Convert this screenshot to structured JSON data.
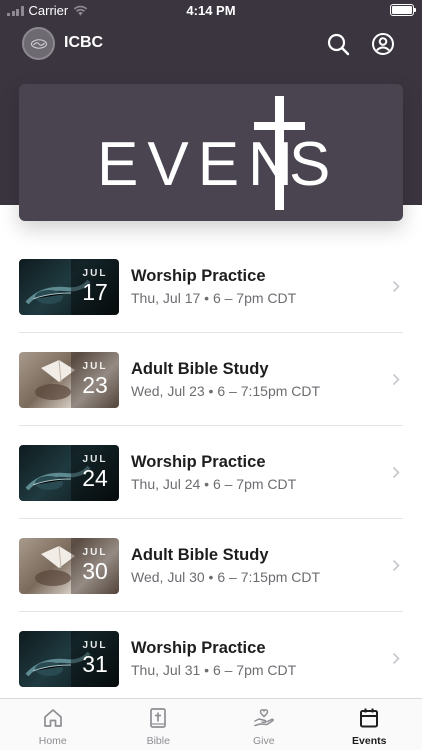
{
  "status_bar": {
    "carrier": "Carrier",
    "time": "4:14 PM"
  },
  "header": {
    "app_name": "ICBC"
  },
  "banner": {
    "text_left": "EVEN",
    "text_right": "S"
  },
  "events": [
    {
      "month": "JUL",
      "day": "17",
      "title": "Worship Practice",
      "subtitle": "Thu, Jul 17 • 6 – 7pm CDT",
      "image": "guitar"
    },
    {
      "month": "JUL",
      "day": "23",
      "title": "Adult Bible Study",
      "subtitle": "Wed, Jul 23 • 6 – 7:15pm CDT",
      "image": "bible"
    },
    {
      "month": "JUL",
      "day": "24",
      "title": "Worship Practice",
      "subtitle": "Thu, Jul 24 • 6 – 7pm CDT",
      "image": "guitar"
    },
    {
      "month": "JUL",
      "day": "30",
      "title": "Adult Bible Study",
      "subtitle": "Wed, Jul 30 • 6 – 7:15pm CDT",
      "image": "bible"
    },
    {
      "month": "JUL",
      "day": "31",
      "title": "Worship Practice",
      "subtitle": "Thu, Jul 31 • 6 – 7pm CDT",
      "image": "guitar"
    }
  ],
  "tabs": [
    {
      "label": "Home",
      "icon": "home-icon"
    },
    {
      "label": "Bible",
      "icon": "bible-icon"
    },
    {
      "label": "Give",
      "icon": "give-icon"
    },
    {
      "label": "Events",
      "icon": "calendar-icon",
      "active": true
    }
  ],
  "colors": {
    "header_bg": "#3b3540",
    "banner_bg": "#4a4450",
    "active_tab": "#1e1e1e",
    "inactive_tab": "#8e8e93"
  }
}
